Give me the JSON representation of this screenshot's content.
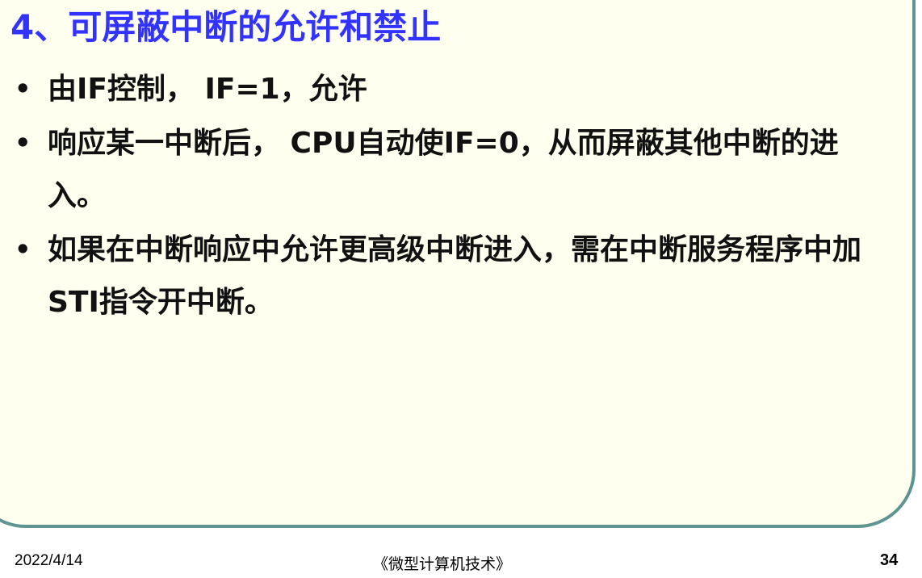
{
  "slide": {
    "title": "4、可屏蔽中断的允许和禁止",
    "bullets": [
      {
        "marker": "•",
        "text": "由IF控制， IF=1，允许"
      },
      {
        "marker": "•",
        "text": "响应某一中断后， CPU自动使IF=0，从而屏蔽其他中断的进入。"
      },
      {
        "marker": "•",
        "text": "如果在中断响应中允许更高级中断进入，需在中断服务程序中加STI指令开中断。"
      }
    ]
  },
  "footer": {
    "date": "2022/4/14",
    "course": "《微型计算机技术》",
    "page_number": "34"
  },
  "colors": {
    "title": "#3333ff",
    "slide_background": "#fffff0",
    "frame_border": "#5e9491",
    "text": "#111111"
  }
}
